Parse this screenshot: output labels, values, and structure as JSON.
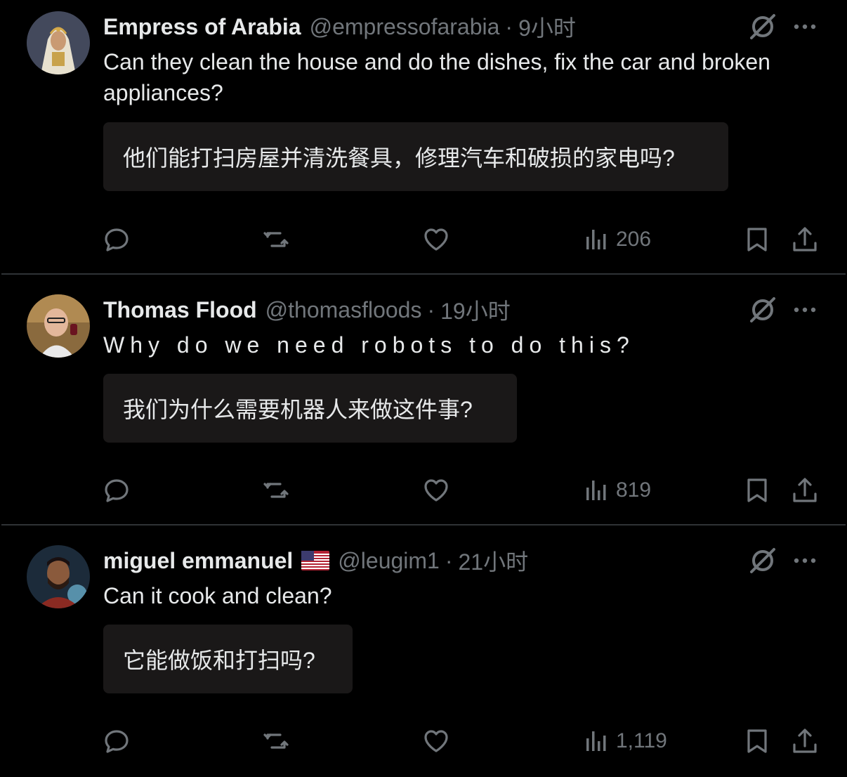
{
  "tweets": [
    {
      "display_name": "Empress of Arabia",
      "handle": "@empressofarabia",
      "separator": "·",
      "time": "9小时",
      "text": "Can they clean the house and do the dishes, fix the car and broken appliances?",
      "translation": "他们能打扫房屋并清洗餐具，修理汽车和破损的家电吗?",
      "views": "206"
    },
    {
      "display_name": "Thomas Flood",
      "handle": "@thomasfloods",
      "separator": "·",
      "time": "19小时",
      "text": "Why do we need robots to do this?",
      "translation": "我们为什么需要机器人来做这件事?",
      "views": "819"
    },
    {
      "display_name": "miguel emmanuel",
      "flag": "us-flag",
      "handle": "@leugim1",
      "separator": "·",
      "time": "21小时",
      "text": "Can it cook and clean?",
      "translation": "它能做饭和打扫吗?",
      "views": "1,119"
    }
  ],
  "icons": {
    "reply": "reply-icon",
    "repost": "repost-icon",
    "like": "heart-icon",
    "views": "views-icon",
    "bookmark": "bookmark-icon",
    "share": "share-icon",
    "grok": "grok-icon",
    "more": "more-icon"
  },
  "colors": {
    "background": "#000000",
    "text": "#e7e9ea",
    "secondary": "#71767b",
    "translation_bg": "#1a1818",
    "divider": "#2f3336"
  }
}
